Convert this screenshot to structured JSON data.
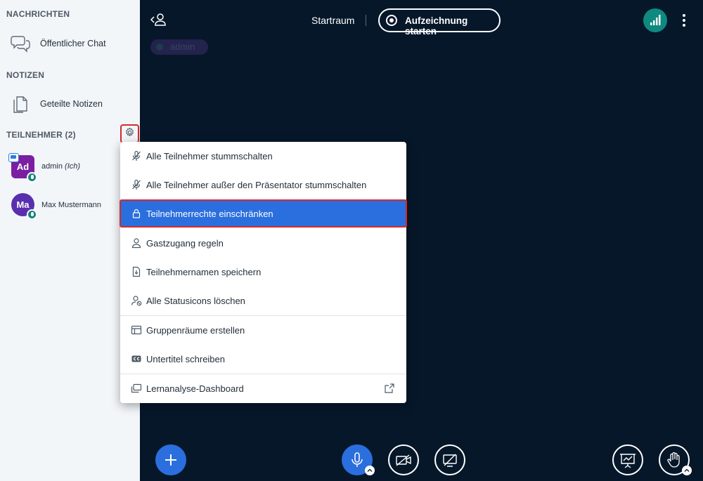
{
  "sidebar": {
    "messages_title": "NACHRICHTEN",
    "public_chat": "Öffentlicher Chat",
    "notes_title": "NOTIZEN",
    "shared_notes": "Geteilte Notizen",
    "participants_title": "TEILNEHMER (2)",
    "users": [
      {
        "initials": "Ad",
        "name": "admin",
        "suffix": "(Ich)"
      },
      {
        "initials": "Ma",
        "name": "Max Mustermann",
        "suffix": ""
      }
    ]
  },
  "topbar": {
    "room": "Startraum",
    "record": "Aufzeichnung starten",
    "presenter_tag": "admin"
  },
  "menu": {
    "items": [
      {
        "label": "Alle Teilnehmer stummschalten",
        "icon": "mic-off-icon"
      },
      {
        "label": "Alle Teilnehmer außer den Präsentator stummschalten",
        "icon": "mic-off-icon"
      },
      {
        "label": "Teilnehmerrechte einschränken",
        "icon": "lock-icon"
      },
      {
        "label": "Gastzugang regeln",
        "icon": "user-icon"
      },
      {
        "label": "Teilnehmernamen speichern",
        "icon": "file-download-icon"
      },
      {
        "label": "Alle Statusicons löschen",
        "icon": "user-clear-icon"
      },
      {
        "label": "Gruppenräume erstellen",
        "icon": "rooms-icon"
      },
      {
        "label": "Untertitel schreiben",
        "icon": "closed-caption-icon"
      },
      {
        "label": "Lernanalyse-Dashboard",
        "icon": "dashboard-icon"
      }
    ]
  },
  "colors": {
    "accent": "#2b6ede",
    "highlight_border": "#d62a2a",
    "main_bg": "#06172a",
    "sidebar_bg": "#f3f6f9",
    "connection": "#0e8a80"
  }
}
